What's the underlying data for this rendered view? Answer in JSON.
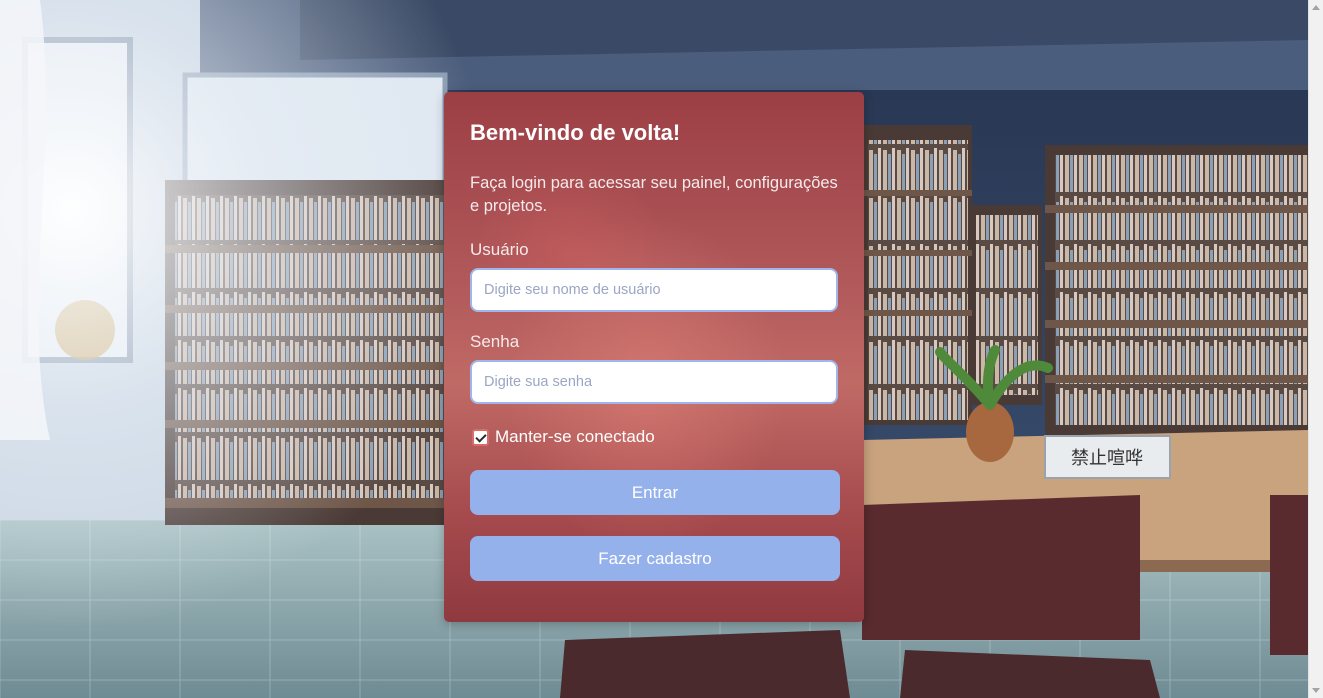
{
  "login": {
    "title": "Bem-vindo de volta!",
    "subtitle": "Faça login para acessar seu painel, configurações e projetos.",
    "username_label": "Usuário",
    "username_placeholder": "Digite seu nome de usuário",
    "username_value": "",
    "password_label": "Senha",
    "password_placeholder": "Digite sua senha",
    "password_value": "",
    "remember_label": "Manter-se conectado",
    "remember_checked": true,
    "login_button": "Entrar",
    "register_button": "Fazer cadastro"
  },
  "background": {
    "sign_text": "禁止喧哗"
  },
  "colors": {
    "card_tint": "#a84a4e",
    "button": "#94b1ec",
    "input_border": "#9fb5ec"
  }
}
